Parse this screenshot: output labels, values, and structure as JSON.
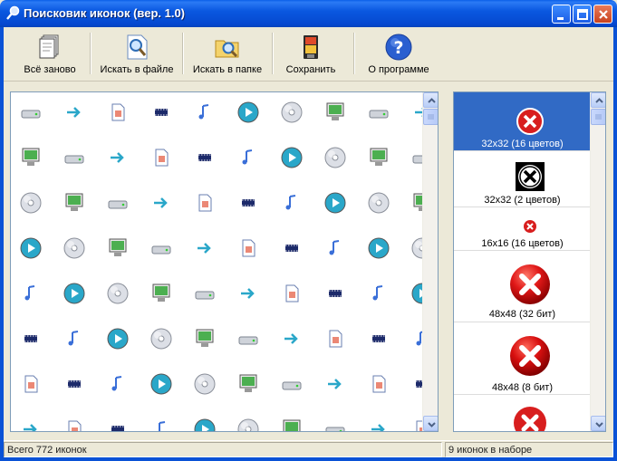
{
  "window": {
    "title": "Поисковик иконок (вер. 1.0)"
  },
  "toolbar": {
    "buttons": [
      {
        "label": "Всё заново",
        "icon": "new-pages-icon"
      },
      {
        "label": "Искать в файле",
        "icon": "search-file-icon"
      },
      {
        "label": "Искать в папке",
        "icon": "search-folder-icon"
      },
      {
        "label": "Сохранить",
        "icon": "save-floppy-icon"
      },
      {
        "label": "О программе",
        "icon": "help-question-icon"
      }
    ]
  },
  "icon_grid": {
    "rows": 8,
    "cols": 10
  },
  "icon_set": {
    "items": [
      {
        "caption": "32x32 (16 цветов)",
        "selected": true
      },
      {
        "caption": "32x32 (2 цветов)",
        "selected": false
      },
      {
        "caption": "16x16 (16 цветов)",
        "selected": false
      },
      {
        "caption": "48x48 (32 бит)",
        "selected": false
      },
      {
        "caption": "48x48 (8 бит)",
        "selected": false
      }
    ]
  },
  "status": {
    "total": "Всего 772 иконок",
    "in_set": "9 иконок в наборе"
  },
  "colors": {
    "titlebar": "#0a58e0",
    "selection": "#316ac5",
    "error_red": "#d81e1e"
  }
}
